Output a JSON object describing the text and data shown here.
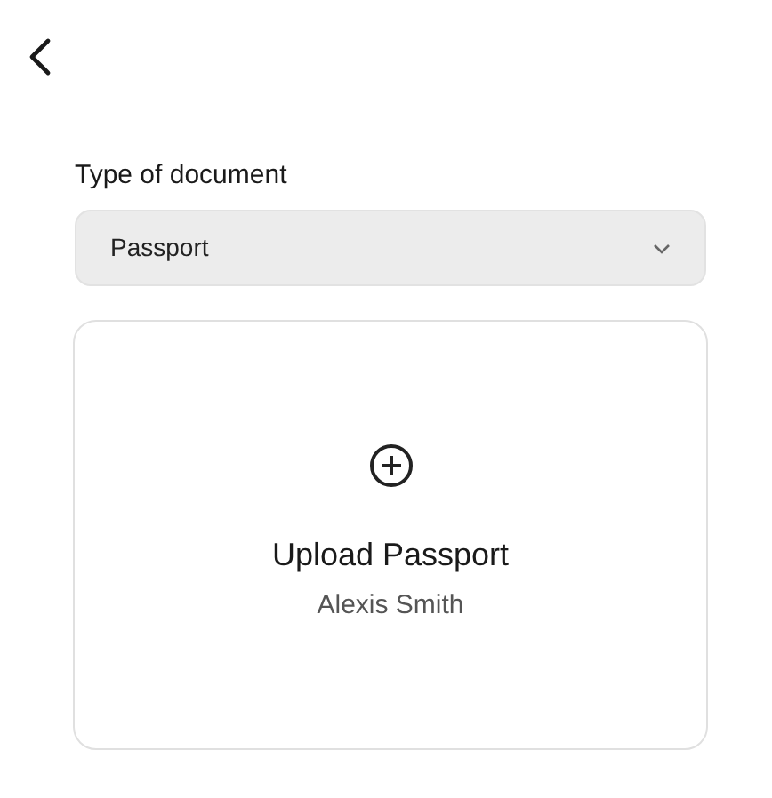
{
  "field": {
    "label": "Type of document",
    "value": "Passport"
  },
  "upload_card": {
    "title": "Upload Passport",
    "subtitle": "Alexis Smith"
  }
}
